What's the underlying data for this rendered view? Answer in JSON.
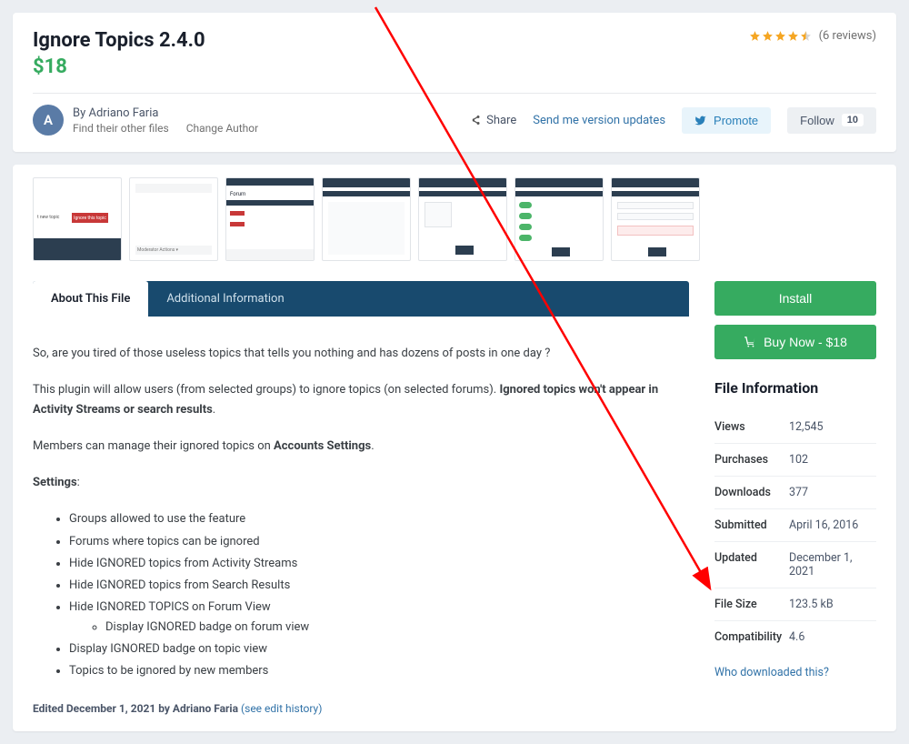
{
  "header": {
    "title": "Ignore Topics 2.4.0",
    "price": "$18",
    "reviews_text": "(6 reviews)",
    "stars": 4.5
  },
  "author": {
    "initial": "A",
    "by_line": "By Adriano Faria",
    "find_other": "Find their other files",
    "change_author": "Change Author"
  },
  "actions": {
    "share": "Share",
    "version_updates": "Send me version updates",
    "promote": "Promote",
    "follow": "Follow",
    "follow_count": "10"
  },
  "tabs": {
    "about": "About This File",
    "additional": "Additional Information"
  },
  "content": {
    "p1": "So, are you tired of those useless topics that tells you nothing and has dozens of posts in one day ?",
    "p2a": "This plugin will allow users (from selected groups) to ignore topics (on selected forums). ",
    "p2b": "Ignored topics won't appear in Activity Streams or search results",
    "p3a": "Members can manage their ignored topics on ",
    "p3b": "Accounts Settings",
    "settings_label": "Settings",
    "bullets": [
      "Groups allowed to use the feature",
      "Forums where topics can be ignored",
      "Hide IGNORED topics from Activity Streams",
      "Hide IGNORED topics from Search Results",
      "Hide IGNORED TOPICS on Forum View",
      "Display IGNORED badge on topic view",
      "Topics to be ignored by new members"
    ],
    "sub_bullet": "Display IGNORED badge on forum view",
    "edited_prefix": "Edited ",
    "edited_date": "December 1, 2021",
    "edited_by": " by Adriano Faria ",
    "edit_history": "(see edit history)"
  },
  "sidebar": {
    "install": "Install",
    "buy": "Buy Now - $18",
    "heading": "File Information",
    "rows": [
      {
        "label": "Views",
        "value": "12,545"
      },
      {
        "label": "Purchases",
        "value": "102"
      },
      {
        "label": "Downloads",
        "value": "377"
      },
      {
        "label": "Submitted",
        "value": "April 16, 2016"
      },
      {
        "label": "Updated",
        "value": "December 1, 2021"
      },
      {
        "label": "File Size",
        "value": "123.5 kB"
      },
      {
        "label": "Compatibility",
        "value": "4.6"
      }
    ],
    "who_downloaded": "Who downloaded this?"
  },
  "icons": {
    "share": "share-icon",
    "twitter": "twitter-icon",
    "cart": "cart-icon"
  }
}
